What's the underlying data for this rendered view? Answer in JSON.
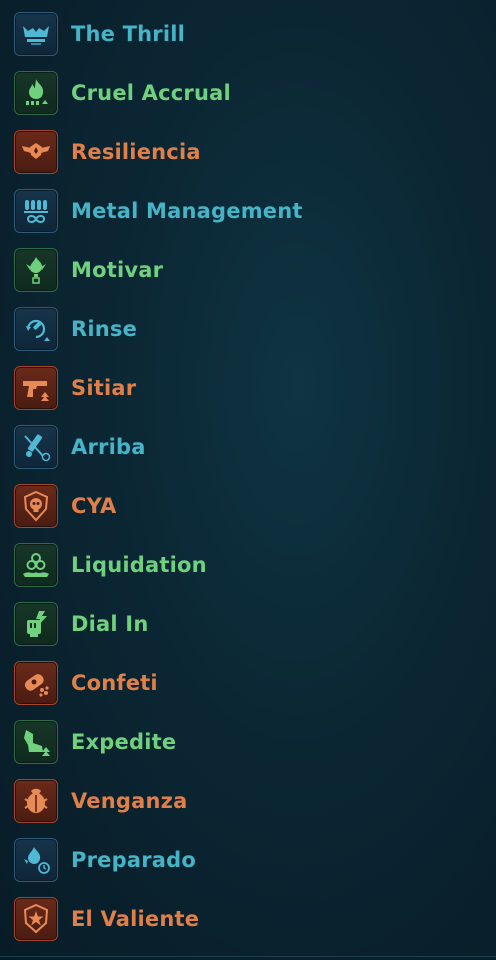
{
  "colors": {
    "blue": "#45b4c7",
    "green": "#6fd07e",
    "orange": "#e07f48",
    "background": "#0b2633"
  },
  "items": [
    {
      "label": "The Thrill",
      "color": "blue",
      "icon": "thrill-icon"
    },
    {
      "label": "Cruel Accrual",
      "color": "green",
      "icon": "flame-stacks-icon"
    },
    {
      "label": "Resiliencia",
      "color": "orange",
      "icon": "winged-badge-icon"
    },
    {
      "label": "Metal Management",
      "color": "blue",
      "icon": "ammo-icon"
    },
    {
      "label": "Motivar",
      "color": "green",
      "icon": "flame-person-icon"
    },
    {
      "label": "Rinse",
      "color": "blue",
      "icon": "refresh-syringe-icon"
    },
    {
      "label": "Sitiar",
      "color": "orange",
      "icon": "pistol-icon"
    },
    {
      "label": "Arriba",
      "color": "blue",
      "icon": "crossed-syringe-icon"
    },
    {
      "label": "CYA",
      "color": "orange",
      "icon": "skull-shield-icon"
    },
    {
      "label": "Liquidation",
      "color": "green",
      "icon": "biohazard-icon"
    },
    {
      "label": "Dial In",
      "color": "green",
      "icon": "fist-icon"
    },
    {
      "label": "Confeti",
      "color": "orange",
      "icon": "grenade-icon"
    },
    {
      "label": "Expedite",
      "color": "green",
      "icon": "boot-icon"
    },
    {
      "label": "Venganza",
      "color": "orange",
      "icon": "scarab-icon"
    },
    {
      "label": "Preparado",
      "color": "blue",
      "icon": "flame-timer-icon"
    },
    {
      "label": "El Valiente",
      "color": "orange",
      "icon": "star-badge-icon"
    }
  ]
}
